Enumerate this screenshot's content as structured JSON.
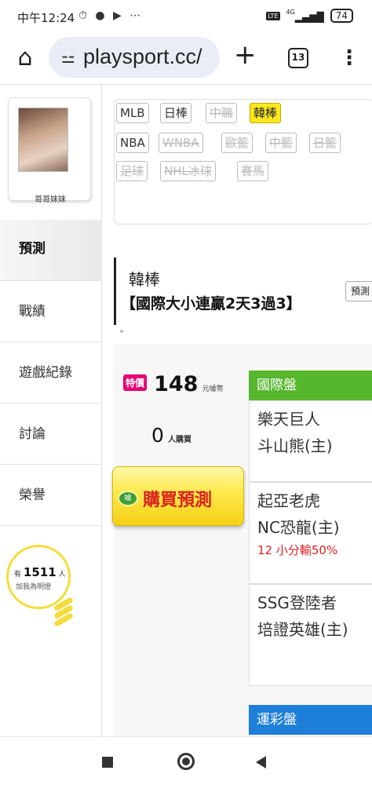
{
  "status_bar": {
    "time": "中午12:24",
    "icons": "⏱ ● ▶ ⋯",
    "network": "4G",
    "lte": "LTE",
    "battery": "74"
  },
  "browser": {
    "url": "playsport.cc/",
    "tab_count": "13",
    "home_icon": "⌂",
    "new_tab_icon": "+",
    "menu_icon": "⋮",
    "tune_icon": "⚲"
  },
  "user": {
    "name": "哥哥妹妹"
  },
  "sidebar": {
    "items": [
      {
        "label": "預測",
        "active": true
      },
      {
        "label": "戰績"
      },
      {
        "label": "遊戲紀錄"
      },
      {
        "label": "討論"
      },
      {
        "label": "榮譽"
      }
    ],
    "fans": {
      "prefix": "有",
      "count": "1511",
      "suffix": "人",
      "sub": "加我為明燈"
    }
  },
  "filters": {
    "row1": [
      "MLB",
      "日棒",
      "中職",
      "韓棒"
    ],
    "row2": [
      "NBA",
      "WNBA",
      "歐籃",
      "中籃",
      "日籃"
    ],
    "row3": [
      "足球",
      "NHL冰球",
      "賽馬"
    ],
    "active": "韓棒",
    "disabled": [
      "中職",
      "WNBA",
      "歐籃",
      "中籃",
      "日籃",
      "足球",
      "NHL冰球",
      "賽馬"
    ]
  },
  "prediction": {
    "category": "韓棒",
    "name": "【國際大小連贏2天3過3】",
    "button": "預測",
    "badge": "特價",
    "price": "148",
    "price_unit": "元噱幣",
    "buyers": "0",
    "buyers_unit": "人購買",
    "buy_button": "購買預測",
    "coin_label": "噱"
  },
  "markets": {
    "intl": {
      "title": "國際盤",
      "games": [
        {
          "away": "樂天巨人",
          "home": "斗山熊(主)",
          "result": ""
        },
        {
          "away": "起亞老虎",
          "home": "NC恐龍(主)",
          "result": "12 小分輸50%"
        },
        {
          "away": "SSG登陸者",
          "home": "培證英雄(主)",
          "result": ""
        }
      ]
    },
    "sports_lottery": {
      "title": "運彩盤"
    }
  },
  "colors": {
    "active_tag": "#ffe81c",
    "intl_header": "#56b62c",
    "lottery_header": "#1e7fd8",
    "badge": "#e60073",
    "loss_text": "#dd2222"
  }
}
